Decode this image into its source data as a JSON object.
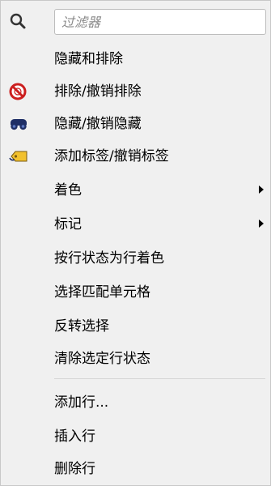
{
  "filter": {
    "placeholder": "过滤器",
    "icon": "search-icon"
  },
  "menu": {
    "items": [
      {
        "label": "隐藏和排除",
        "icon": null,
        "submenu": false
      },
      {
        "label": "排除/撤销排除",
        "icon": "exclude-icon",
        "submenu": false
      },
      {
        "label": "隐藏/撤销隐藏",
        "icon": "hide-icon",
        "submenu": false
      },
      {
        "label": "添加标签/撤销标签",
        "icon": "tag-icon",
        "submenu": false
      },
      {
        "label": "着色",
        "icon": null,
        "submenu": true
      },
      {
        "label": "标记",
        "icon": null,
        "submenu": true
      },
      {
        "label": "按行状态为行着色",
        "icon": null,
        "submenu": false
      },
      {
        "label": "选择匹配单元格",
        "icon": null,
        "submenu": false
      },
      {
        "label": "反转选择",
        "icon": null,
        "submenu": false
      },
      {
        "label": "清除选定行状态",
        "icon": null,
        "submenu": false
      }
    ],
    "items_after_separator": [
      {
        "label": "添加行...",
        "icon": null,
        "submenu": false
      },
      {
        "label": "插入行",
        "icon": null,
        "submenu": false
      },
      {
        "label": "删除行",
        "icon": null,
        "submenu": false
      }
    ]
  },
  "colors": {
    "exclude_red": "#cc1f1f",
    "hide_navy": "#1f2f66",
    "tag_yellow": "#f2c12e"
  }
}
